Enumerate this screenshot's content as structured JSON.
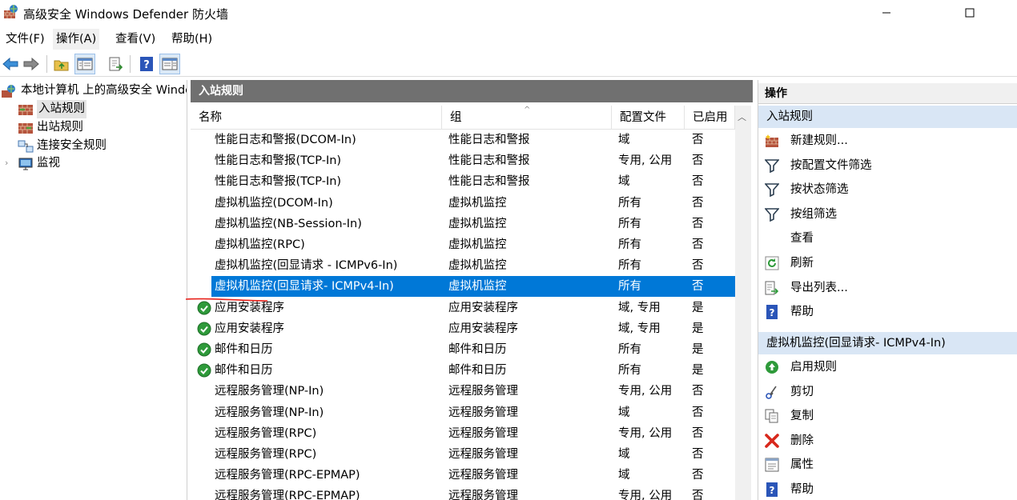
{
  "window": {
    "title": "高级安全 Windows Defender 防火墙"
  },
  "menu": [
    "文件(F)",
    "操作(A)",
    "查看(V)",
    "帮助(H)"
  ],
  "tree": {
    "root": "本地计算机 上的高级安全 Windows Defender 防火墙",
    "items": [
      "入站规则",
      "出站规则",
      "连接安全规则",
      "监视"
    ]
  },
  "middle": {
    "header": "入站规则",
    "columns": [
      "名称",
      "组",
      "配置文件",
      "已启用"
    ],
    "rows": [
      {
        "name": "性能日志和警报(DCOM-In)",
        "group": "性能日志和警报",
        "profile": "域",
        "enabled": "否",
        "check": false
      },
      {
        "name": "性能日志和警报(TCP-In)",
        "group": "性能日志和警报",
        "profile": "专用, 公用",
        "enabled": "否",
        "check": false
      },
      {
        "name": "性能日志和警报(TCP-In)",
        "group": "性能日志和警报",
        "profile": "域",
        "enabled": "否",
        "check": false
      },
      {
        "name": "虚拟机监控(DCOM-In)",
        "group": "虚拟机监控",
        "profile": "所有",
        "enabled": "否",
        "check": false
      },
      {
        "name": "虚拟机监控(NB-Session-In)",
        "group": "虚拟机监控",
        "profile": "所有",
        "enabled": "否",
        "check": false
      },
      {
        "name": "虚拟机监控(RPC)",
        "group": "虚拟机监控",
        "profile": "所有",
        "enabled": "否",
        "check": false
      },
      {
        "name": "虚拟机监控(回显请求 - ICMPv6-In)",
        "group": "虚拟机监控",
        "profile": "所有",
        "enabled": "否",
        "check": false
      },
      {
        "name": "虚拟机监控(回显请求- ICMPv4-In)",
        "group": "虚拟机监控",
        "profile": "所有",
        "enabled": "否",
        "check": false,
        "selected": true
      },
      {
        "name": "应用安装程序",
        "group": "应用安装程序",
        "profile": "域, 专用",
        "enabled": "是",
        "check": true
      },
      {
        "name": "应用安装程序",
        "group": "应用安装程序",
        "profile": "域, 专用",
        "enabled": "是",
        "check": true
      },
      {
        "name": "邮件和日历",
        "group": "邮件和日历",
        "profile": "所有",
        "enabled": "是",
        "check": true
      },
      {
        "name": "邮件和日历",
        "group": "邮件和日历",
        "profile": "所有",
        "enabled": "是",
        "check": true
      },
      {
        "name": "远程服务管理(NP-In)",
        "group": "远程服务管理",
        "profile": "专用, 公用",
        "enabled": "否",
        "check": false
      },
      {
        "name": "远程服务管理(NP-In)",
        "group": "远程服务管理",
        "profile": "域",
        "enabled": "否",
        "check": false
      },
      {
        "name": "远程服务管理(RPC)",
        "group": "远程服务管理",
        "profile": "专用, 公用",
        "enabled": "否",
        "check": false
      },
      {
        "name": "远程服务管理(RPC)",
        "group": "远程服务管理",
        "profile": "域",
        "enabled": "否",
        "check": false
      },
      {
        "name": "远程服务管理(RPC-EPMAP)",
        "group": "远程服务管理",
        "profile": "域",
        "enabled": "否",
        "check": false
      },
      {
        "name": "远程服务管理(RPC-EPMAP)",
        "group": "远程服务管理",
        "profile": "专用, 公用",
        "enabled": "否",
        "check": false
      }
    ]
  },
  "actions": {
    "header": "操作",
    "section1": "入站规则",
    "section1_items": [
      {
        "label": "新建规则...",
        "icon": "new-rule-icon"
      },
      {
        "label": "按配置文件筛选",
        "icon": "filter-icon"
      },
      {
        "label": "按状态筛选",
        "icon": "filter-icon"
      },
      {
        "label": "按组筛选",
        "icon": "filter-icon"
      },
      {
        "label": "查看",
        "icon": ""
      },
      {
        "label": "刷新",
        "icon": "refresh-icon"
      },
      {
        "label": "导出列表...",
        "icon": "export-icon"
      },
      {
        "label": "帮助",
        "icon": "help-icon"
      }
    ],
    "section2": "虚拟机监控(回显请求- ICMPv4-In)",
    "section2_items": [
      {
        "label": "启用规则",
        "icon": "enable-rule-icon"
      },
      {
        "label": "剪切",
        "icon": "cut-icon"
      },
      {
        "label": "复制",
        "icon": "copy-icon"
      },
      {
        "label": "删除",
        "icon": "delete-icon"
      },
      {
        "label": "属性",
        "icon": "properties-icon"
      },
      {
        "label": "帮助",
        "icon": "help-icon"
      }
    ]
  },
  "colors": {
    "selection": "#0078d7",
    "pane_header": "#707070",
    "action_section": "#d9e6f5",
    "annotation": "#e8231c"
  }
}
